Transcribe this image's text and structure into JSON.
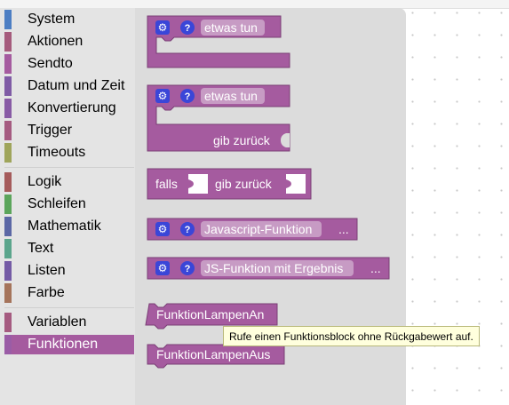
{
  "toolbox": {
    "categories": [
      {
        "label": "System",
        "color": "#4c7ec3"
      },
      {
        "label": "Aktionen",
        "color": "#a55b7c"
      },
      {
        "label": "Sendto",
        "color": "#a55b9f"
      },
      {
        "label": "Datum und Zeit",
        "color": "#7f5ba5"
      },
      {
        "label": "Konvertierung",
        "color": "#885ba5"
      },
      {
        "label": "Trigger",
        "color": "#a55b80"
      },
      {
        "label": "Timeouts",
        "color": "#9fa55b"
      },
      {
        "label": "Logik",
        "color": "#a55b5b"
      },
      {
        "label": "Schleifen",
        "color": "#5ba55b"
      },
      {
        "label": "Mathematik",
        "color": "#5b67a5"
      },
      {
        "label": "Text",
        "color": "#5ba58c"
      },
      {
        "label": "Listen",
        "color": "#745ba5"
      },
      {
        "label": "Farbe",
        "color": "#a5745b"
      },
      {
        "label": "Variablen",
        "color": "#a55b80"
      },
      {
        "label": "Funktionen",
        "color": "#9a5ca6"
      }
    ]
  },
  "flyout": {
    "block1": {
      "text": "etwas tun"
    },
    "block2": {
      "text": "etwas tun",
      "return_label": "gib zurück"
    },
    "block3": {
      "if_label": "falls",
      "return_label": "gib zurück"
    },
    "block4": {
      "text": "Javascript-Funktion",
      "dots": "..."
    },
    "block5": {
      "text": "JS-Funktion mit Ergebnis",
      "dots": "..."
    },
    "call1": {
      "text": "FunktionLampenAn"
    },
    "call2": {
      "text": "FunktionLampenAus"
    }
  },
  "tooltip": {
    "text": "Rufe einen Funktionsblock ohne Rückgabewert auf."
  },
  "colors": {
    "function_block": "#a55b9f",
    "selected_category": "#a55b9f",
    "highlight": "#f5c518"
  }
}
